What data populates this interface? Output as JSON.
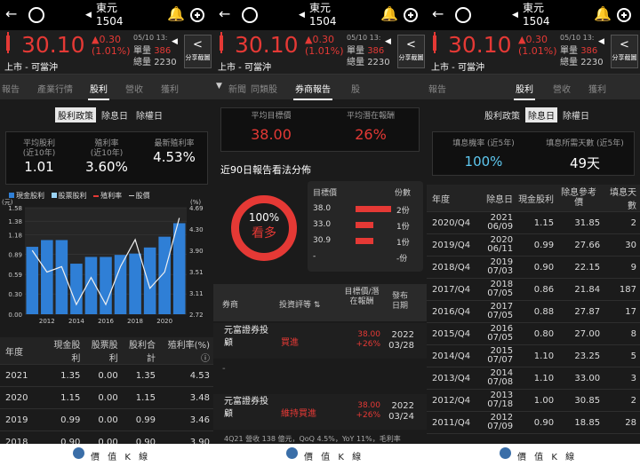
{
  "header": {
    "stock_name": "東元",
    "stock_code": "1504"
  },
  "quote": {
    "price": "30.10",
    "change": "▲0.30",
    "change_pct": "(1.01%)",
    "date": "05/10",
    "time": "13:",
    "unit_label": "單量",
    "unit_value": "386",
    "total_label": "總量",
    "total_value": "2230",
    "market": "上市 - 可當沖",
    "share_label": "分享截圖"
  },
  "p1": {
    "tabs": [
      "報告",
      "產業行情",
      "股利",
      "營收",
      "獲利"
    ],
    "segments": [
      "股利政策",
      "除息日",
      "除權日"
    ],
    "stats": [
      {
        "label": "平均股利",
        "sub": "(近10年)",
        "value": "1.01"
      },
      {
        "label": "殖利率",
        "sub": "(近10年)",
        "value": "3.60%"
      },
      {
        "label": "最新殖利率",
        "sub": "",
        "value": "4.53%"
      }
    ],
    "legend": [
      "現金股利",
      "股票股利",
      "殖利率",
      "股價"
    ],
    "table_headers": [
      "年度",
      "現金股利",
      "股票股利",
      "股利合計",
      "殖利率(%)"
    ],
    "rows": [
      [
        "2021",
        "1.35",
        "0.00",
        "1.35",
        "4.53"
      ],
      [
        "2020",
        "1.15",
        "0.00",
        "1.15",
        "3.48"
      ],
      [
        "2019",
        "0.99",
        "0.00",
        "0.99",
        "3.46"
      ],
      [
        "2018",
        "0.90",
        "0.00",
        "0.90",
        "3.90"
      ]
    ]
  },
  "chart_data": {
    "type": "bar",
    "x": [
      2011,
      2012,
      2013,
      2014,
      2015,
      2016,
      2017,
      2018,
      2019,
      2020,
      2021
    ],
    "x_tick_labels": [
      "2012",
      "2014",
      "2016",
      "2018",
      "2020"
    ],
    "series": [
      {
        "name": "現金股利",
        "values": [
          1.0,
          1.1,
          1.1,
          0.75,
          0.85,
          0.85,
          0.88,
          0.9,
          0.99,
          1.15,
          1.35
        ]
      },
      {
        "name": "殖利率",
        "axis": "right",
        "values": [
          3.9,
          3.5,
          3.6,
          2.9,
          3.4,
          2.9,
          3.6,
          4.1,
          3.2,
          3.5,
          4.5
        ]
      }
    ],
    "ylabel_left": "(元)",
    "ylabel_right": "(%)",
    "yticks_left": [
      "1.58",
      "1.38",
      "1.18",
      "0.89",
      "0.59",
      "0.30",
      "0.00"
    ],
    "yticks_right": [
      "4.69",
      "4.30",
      "3.90",
      "3.51",
      "3.11",
      "2.72"
    ],
    "ylim": [
      0,
      1.58
    ],
    "ylim_right": [
      2.72,
      4.69
    ]
  },
  "p2": {
    "tabs": [
      "新聞",
      "同類股",
      "券商報告",
      "股"
    ],
    "avg_target_label": "平均目標價",
    "avg_target_value": "38.00",
    "avg_upside_label": "平均潛在報酬",
    "avg_upside_value": "26%",
    "dist_title": "近90日報告看法分佈",
    "donut_pct": "100%",
    "donut_label": "看多",
    "target_header": "目標價",
    "count_header": "份數",
    "targets": [
      {
        "price": "38.0",
        "count": "2份",
        "frac": 1.0
      },
      {
        "price": "33.0",
        "count": "1份",
        "frac": 0.5
      },
      {
        "price": "30.9",
        "count": "1份",
        "frac": 0.5
      },
      {
        "price": "-",
        "count": "-份",
        "frac": 0
      }
    ],
    "list_headers": [
      "券商",
      "投資評等",
      "目標價/潛在報酬",
      "發布日期"
    ],
    "reports": [
      {
        "broker": "元富證券投顧",
        "rating": "買進",
        "target": "38.00",
        "upside": "+26%",
        "year": "2022",
        "date": "03/28"
      },
      {
        "broker": "元富證券投顧",
        "rating": "維持買進",
        "target": "38.00",
        "upside": "+26%",
        "year": "2022",
        "date": "03/24"
      }
    ],
    "dash": "-",
    "snippet": "4Q21 營收 138 億元，QoQ 4.5%，YoY 11%，毛利率"
  },
  "p3": {
    "tabs": [
      "報告",
      "股利",
      "營收",
      "獲利"
    ],
    "segments": [
      "股利政策",
      "除息日",
      "除權日"
    ],
    "stats": [
      {
        "label": "填息機率 (近5年)",
        "value": "100%"
      },
      {
        "label": "填息所需天數 (近5年)",
        "value": "49天"
      }
    ],
    "table_headers": [
      "年度",
      "除息日",
      "現金股利",
      "除息參考價",
      "填息天數"
    ],
    "rows": [
      [
        "2020/Q4",
        "2021 06/09",
        "1.15",
        "31.85",
        "2"
      ],
      [
        "2019/Q4",
        "2020 06/11",
        "0.99",
        "27.66",
        "30"
      ],
      [
        "2018/Q4",
        "2019 07/03",
        "0.90",
        "22.15",
        "9"
      ],
      [
        "2017/Q4",
        "2018 07/05",
        "0.86",
        "21.84",
        "187"
      ],
      [
        "2016/Q4",
        "2017 07/05",
        "0.88",
        "27.87",
        "17"
      ],
      [
        "2015/Q4",
        "2016 07/05",
        "0.80",
        "27.00",
        "8"
      ],
      [
        "2014/Q4",
        "2015 07/07",
        "1.10",
        "23.25",
        "5"
      ],
      [
        "2013/Q4",
        "2014 07/08",
        "1.10",
        "33.00",
        "3"
      ],
      [
        "2012/Q4",
        "2013 07/18",
        "1.00",
        "30.85",
        "2"
      ],
      [
        "2011/Q4",
        "2012 07/09",
        "0.90",
        "18.85",
        "28"
      ]
    ]
  },
  "footer": {
    "brand": "價 值 K 線"
  },
  "colors": {
    "up": "#e53935",
    "cash_bar": "#2f7fd6",
    "stock_bar": "#9bd3f7",
    "yield_line": "#f0f0f0",
    "highlight": "#5ec8f0"
  }
}
